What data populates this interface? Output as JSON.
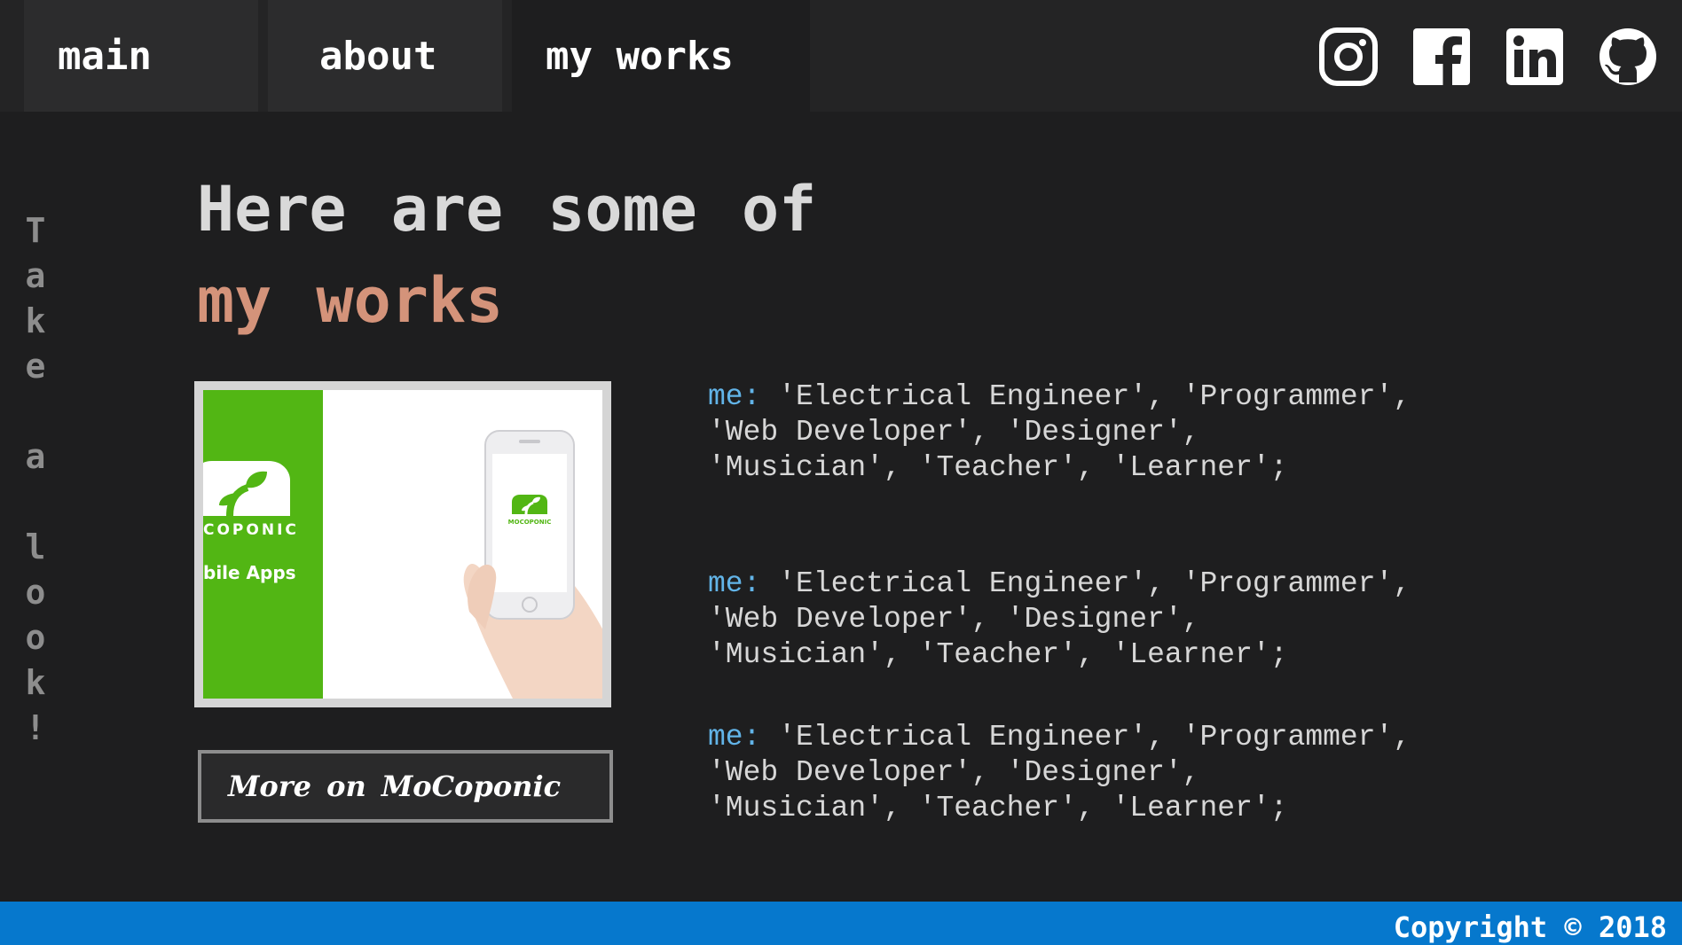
{
  "nav": {
    "tabs": [
      {
        "label": "main"
      },
      {
        "label": "about"
      },
      {
        "label": "my works"
      }
    ],
    "social": [
      "instagram-icon",
      "facebook-icon",
      "linkedin-icon",
      "github-icon"
    ]
  },
  "side_text": [
    "T",
    "a",
    "k",
    "e",
    " ",
    "a",
    " ",
    "l",
    "o",
    "o",
    "k",
    "!"
  ],
  "heading": {
    "line1": "Here are some of",
    "line2": "my works"
  },
  "project": {
    "brand_text": "COPONIC",
    "brand_subtitle": "bile Apps",
    "phone_brand": "MOCOPONIC",
    "button_label": "More on MoCoponic"
  },
  "code_blocks": [
    {
      "keyword": "me:",
      "lines": [
        " 'Electrical Engineer', 'Programmer',",
        "'Web Developer', 'Designer',",
        "'Musician', 'Teacher', 'Learner';"
      ]
    },
    {
      "keyword": "me:",
      "lines": [
        " 'Electrical Engineer', 'Programmer',",
        "'Web Developer', 'Designer',",
        "'Musician', 'Teacher', 'Learner';"
      ]
    },
    {
      "keyword": "me:",
      "lines": [
        " 'Electrical Engineer', 'Programmer',",
        "'Web Developer', 'Designer',",
        "'Musician', 'Teacher', 'Learner';"
      ]
    }
  ],
  "footer": {
    "copyright": "Copyright © 2018"
  },
  "colors": {
    "background": "#1e1e1f",
    "nav_background": "#242425",
    "accent_heading": "#d4937a",
    "code_keyword": "#62b4e8",
    "footer": "#0678cd",
    "brand_green": "#52b614"
  }
}
